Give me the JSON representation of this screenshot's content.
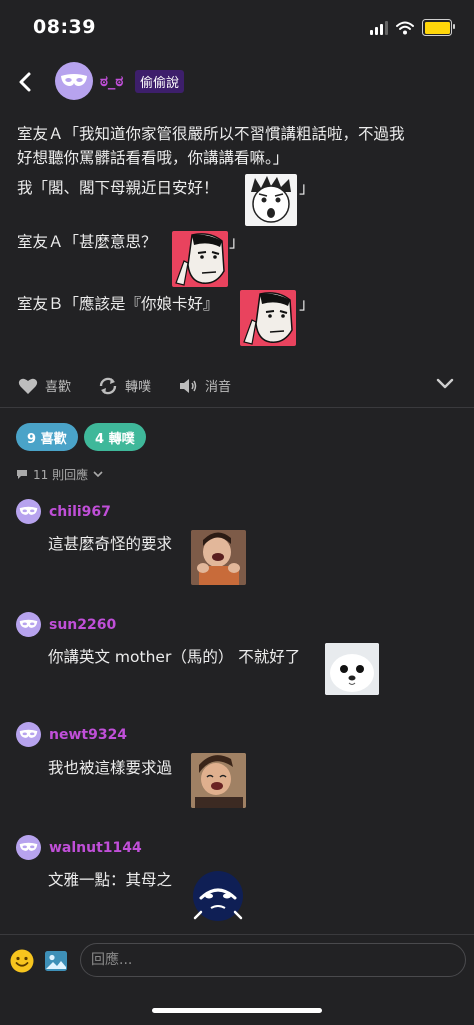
{
  "status_bar": {
    "time": "08:39"
  },
  "header": {
    "handle": "ಠ_ಠ",
    "badge": "偷偷說"
  },
  "post": {
    "line1": "室友Ａ「我知道你家管很嚴所以不習慣講粗話啦，不過我",
    "line2": "好想聽你罵髒話看看哦，你講講看嘛。」",
    "line3": "我「閣、閣下母親近日安好！",
    "line3_end": "」",
    "line4": "室友Ａ「甚麼意思？",
    "line4_end": "」",
    "line5": "室友Ｂ「應該是『你娘卡好』",
    "line5_end": "」"
  },
  "actions": {
    "like": "喜歡",
    "repost": "轉噗",
    "mute": "消音"
  },
  "stats": {
    "likes": "9 喜歡",
    "reposts": "4 轉噗",
    "replies": "11 則回應"
  },
  "comments": [
    {
      "user": "chili967",
      "text": "這甚麼奇怪的要求"
    },
    {
      "user": "sun2260",
      "text": "你講英文 mother（馬的） 不就好了"
    },
    {
      "user": "newt9324",
      "text": "我也被這樣要求過"
    },
    {
      "user": "walnut1144",
      "text": "文雅一點：其母之"
    }
  ],
  "reply_input": {
    "placeholder": "回應..."
  },
  "colors": {
    "background": "#222224",
    "username": "#c04fd8",
    "avatar": "#b7a3ee",
    "likes_pill": "#4aa3c8",
    "reposts_pill": "#3fb89a",
    "badge": "#3d1f6b"
  }
}
